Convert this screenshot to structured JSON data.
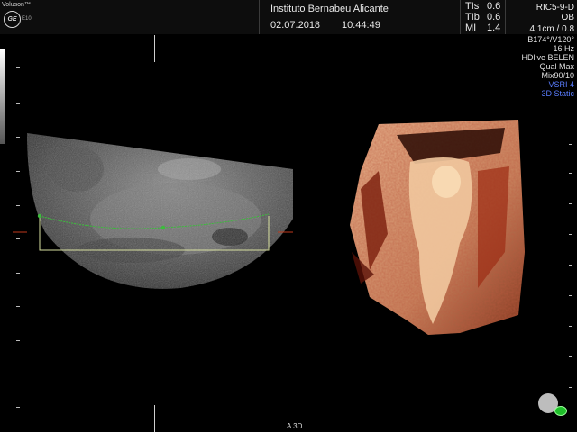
{
  "header": {
    "brand": "Voluson™",
    "model": "E10",
    "logo": "GE",
    "institution": "Instituto Bernabeu Alicante",
    "date": "02.07.2018",
    "time": "10:44:49",
    "indices": [
      {
        "label": "TIs",
        "value": "0.6"
      },
      {
        "label": "TIb",
        "value": "0.6"
      },
      {
        "label": "MI",
        "value": "1.4"
      }
    ],
    "probe": "RIC5-9-D",
    "preset": "OB",
    "depth": "4.1cm / 0.8"
  },
  "params": [
    "B174°/V120°",
    "16 Hz",
    "HDlive BELEN",
    "Qual Max",
    "Mix90/10"
  ],
  "params_blue": [
    "VSRI 4",
    "3D Static"
  ],
  "bottom": {
    "axis_label": "A 3D"
  },
  "colors": {
    "render_accent": "#c0391b",
    "roi_box": "#d8e0a0",
    "roi_curve": "#3cbc3c",
    "blue_text": "#5a7dff"
  }
}
